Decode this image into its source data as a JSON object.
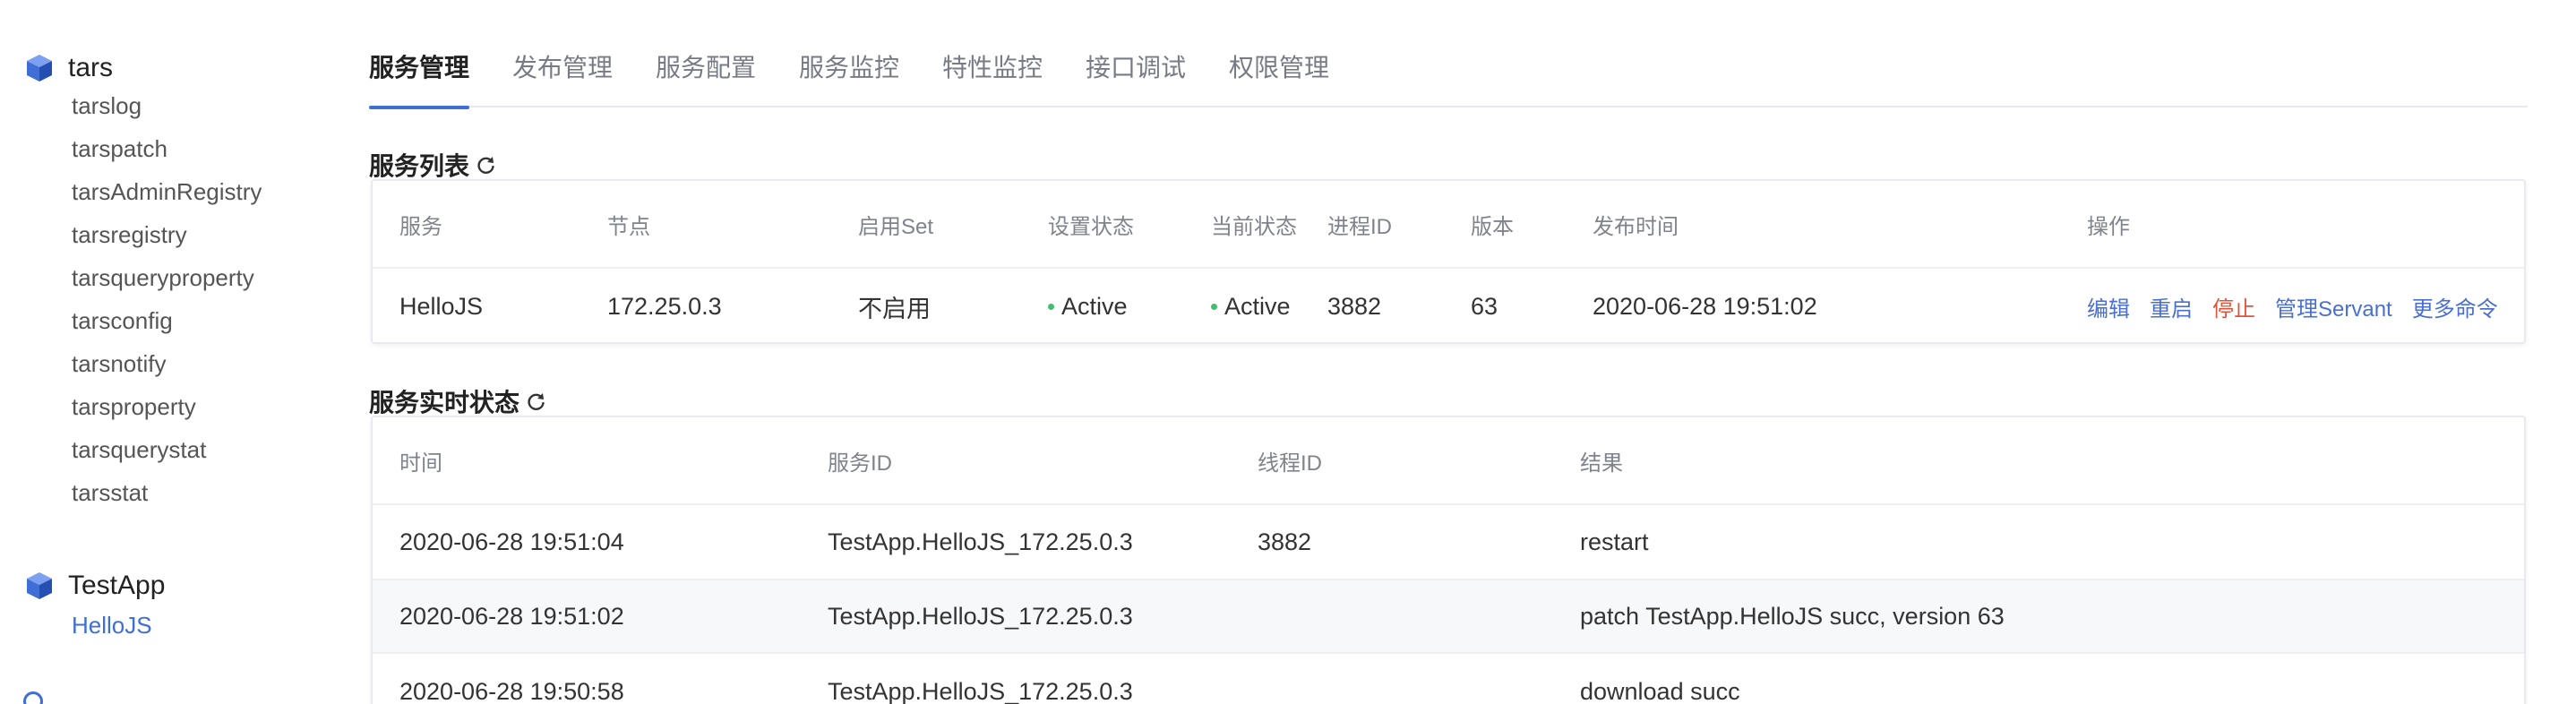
{
  "sidebar": {
    "apps": [
      {
        "name": "tars",
        "services": [
          "tarslog",
          "tarspatch",
          "tarsAdminRegistry",
          "tarsregistry",
          "tarsqueryproperty",
          "tarsconfig",
          "tarsnotify",
          "tarsproperty",
          "tarsquerystat",
          "tarsstat"
        ]
      },
      {
        "name": "TestApp",
        "services": [
          "HelloJS"
        ],
        "selected_service": "HelloJS"
      }
    ]
  },
  "tabs": [
    "服务管理",
    "发布管理",
    "服务配置",
    "服务监控",
    "特性监控",
    "接口调试",
    "权限管理"
  ],
  "active_tab": "服务管理",
  "service_list": {
    "title": "服务列表",
    "columns": [
      "服务",
      "节点",
      "启用Set",
      "设置状态",
      "当前状态",
      "进程ID",
      "版本",
      "发布时间",
      "操作"
    ],
    "rows": [
      {
        "service": "HelloJS",
        "node": "172.25.0.3",
        "set": "不启用",
        "setting_status": "Active",
        "current_status": "Active",
        "pid": "3882",
        "version": "63",
        "publish_time": "2020-06-28 19:51:02",
        "ops": [
          "编辑",
          "重启",
          "停止",
          "管理Servant",
          "更多命令"
        ]
      }
    ]
  },
  "realtime": {
    "title": "服务实时状态",
    "columns": [
      "时间",
      "服务ID",
      "线程ID",
      "结果"
    ],
    "rows": [
      {
        "time": "2020-06-28 19:51:04",
        "service_id": "TestApp.HelloJS_172.25.0.3",
        "thread_id": "3882",
        "result": "restart"
      },
      {
        "time": "2020-06-28 19:51:02",
        "service_id": "TestApp.HelloJS_172.25.0.3",
        "thread_id": "",
        "result": "patch TestApp.HelloJS succ, version 63"
      },
      {
        "time": "2020-06-28 19:50:58",
        "service_id": "TestApp.HelloJS_172.25.0.3",
        "thread_id": "",
        "result": "download succ"
      }
    ]
  },
  "colors": {
    "accent": "#3f6fd6",
    "status_active": "#3fbf6f",
    "danger": "#e0533b",
    "service_link": "#3b2b7a"
  },
  "icons": {
    "app": "cube-icon",
    "refresh": "refresh-icon"
  }
}
